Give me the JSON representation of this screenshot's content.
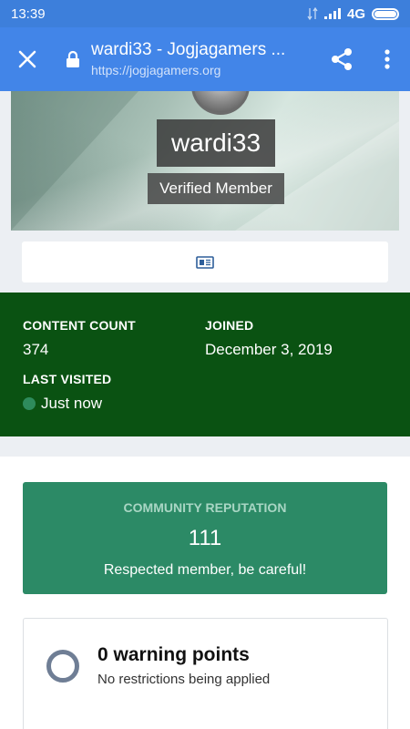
{
  "status_bar": {
    "time": "13:39",
    "network": "4G"
  },
  "browser": {
    "title": "wardi33 - Jogjagamers ...",
    "url": "https://jogjagamers.org",
    "icons": [
      "close-icon",
      "lock-icon",
      "share-icon",
      "more-vert-icon"
    ]
  },
  "profile": {
    "username": "wardi33",
    "member_group": "Verified Member",
    "activity_icon": "newspaper-icon"
  },
  "stats": {
    "content_count_label": "CONTENT COUNT",
    "content_count_value": "374",
    "joined_label": "JOINED",
    "joined_value": "December 3, 2019",
    "last_visited_label": "LAST VISITED",
    "last_visited_value": "Just now"
  },
  "reputation": {
    "label": "COMMUNITY REPUTATION",
    "value": "111",
    "description": "Respected member, be careful!"
  },
  "warnings": {
    "title": "0 warning points",
    "description": "No restrictions being applied"
  },
  "colors": {
    "toolbar": "#4285e8",
    "status_bar": "#3d7fdb",
    "stats_bg": "#0a5212",
    "reputation_bg": "#2c8a66"
  }
}
